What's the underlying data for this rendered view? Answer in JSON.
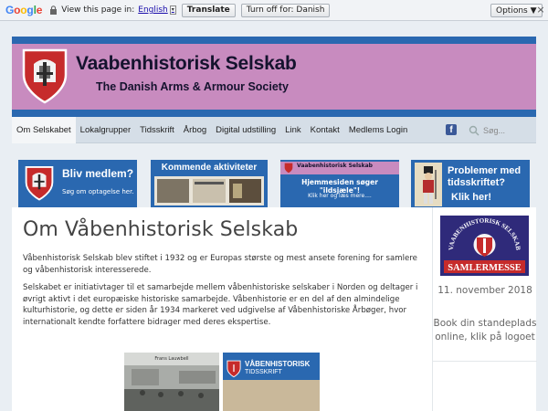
{
  "translate_bar": {
    "logo": "Google",
    "prompt": "View this page in:",
    "language": "English",
    "translate_btn": "Translate",
    "turn_off_btn": "Turn off for: Danish",
    "options_btn": "Options ▼",
    "close": "×"
  },
  "banner": {
    "title": "Vaabenhistorisk Selskab",
    "subtitle": "The Danish Arms & Armour Society"
  },
  "nav": {
    "items": [
      "Om Selskabet",
      "Lokalgrupper",
      "Tidsskrift",
      "Årbog",
      "Digital udstilling",
      "Link",
      "Kontakt",
      "Medlems Login"
    ],
    "search_placeholder": "Søg..."
  },
  "cards": {
    "c1_title": "Bliv medlem?",
    "c1_sub": "Søg om optagelse her.",
    "c2_title": "Kommende aktiviteter",
    "c3_head": "Vaabenhistorisk Selskab",
    "c3_title": "Hjemmesiden søger \"ildsjæle\"!",
    "c3_sub": "Klik her og læs mere....",
    "c4_title": "Problemer med tidsskriftet?",
    "c4_sub": "Klik her!"
  },
  "main": {
    "title": "Om Våbenhistorisk Selskab",
    "p1": "Våbenhistorisk Selskab blev stiftet i 1932 og er Europas største og mest ansete forening for samlere og våbenhistorisk interesserede.",
    "p2": "Selskabet er initiativtager til et samarbejde mellem våbenhistoriske selskaber i Norden og deltager i øvrigt aktivt i det europæiske historiske samarbejde. Våbenhistorie er en del af den almindelige kulturhistorie, og dette er siden år 1934 markeret ved udgivelse af Våbenhistoriske Årbøger, hvor internationalt kendte forfattere bidrager med deres ekspertise.",
    "book1_caption": "Frans Lauwbell",
    "book2_title": "VÅBENHISTORISK",
    "book2_sub": "TIDSSKRIFT"
  },
  "sidebar": {
    "logo_top": "VAABENHISTORISK SELSKAB",
    "logo_bottom": "SAMLERMESSE",
    "date": "11. november 2018",
    "text": "Book din standeplads online, klik på logoet"
  }
}
